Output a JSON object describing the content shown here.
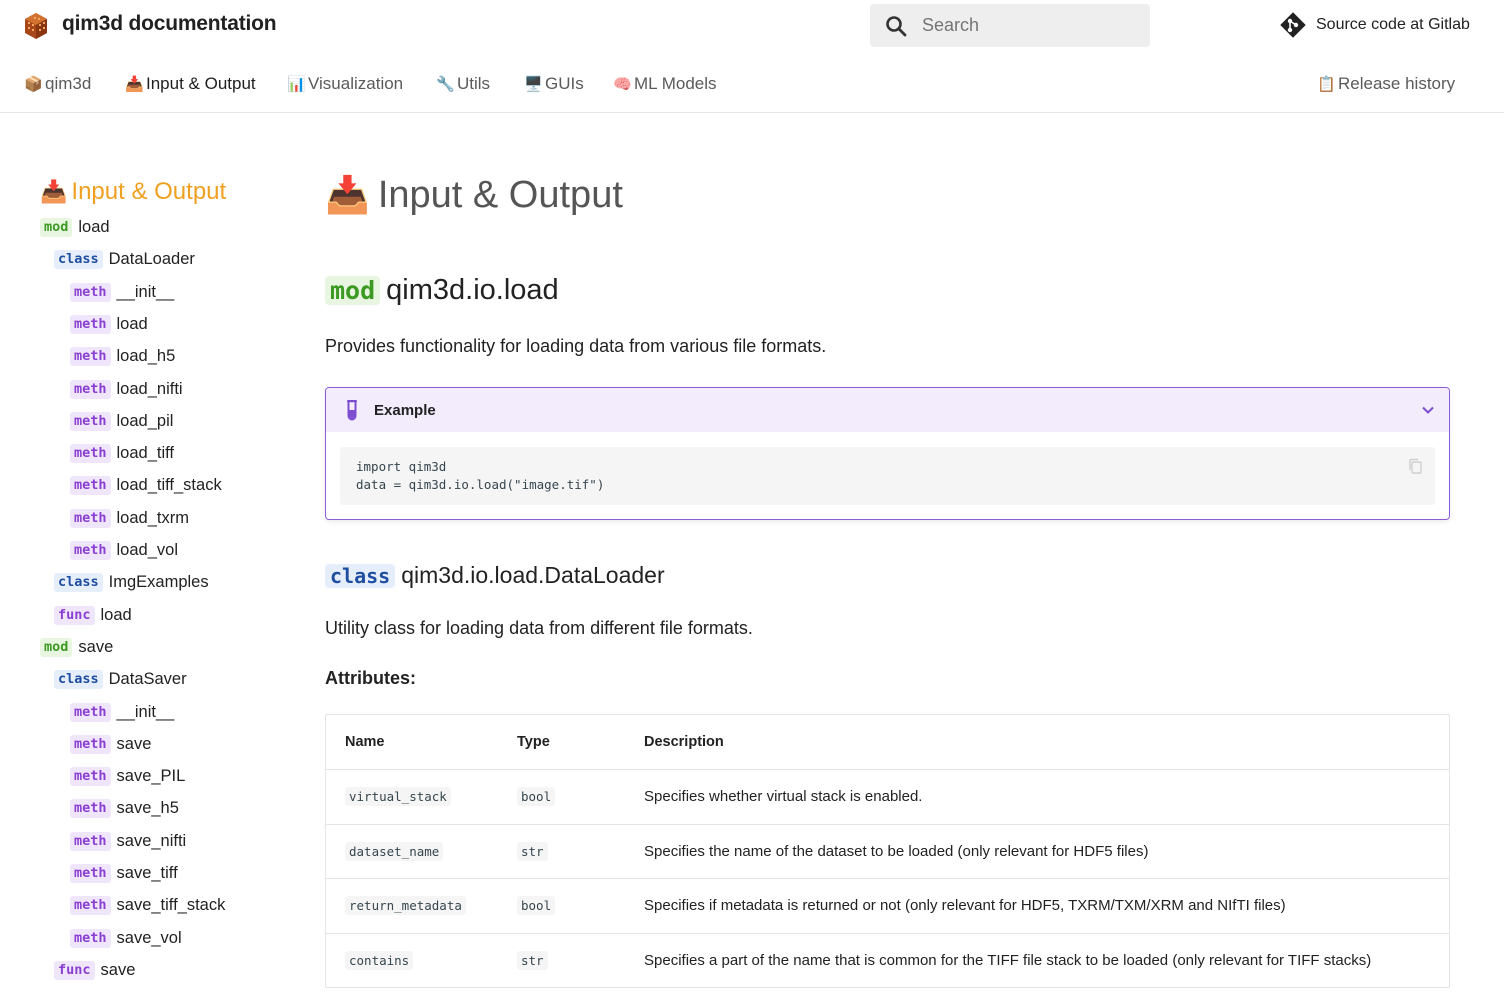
{
  "header": {
    "site_title": "qim3d documentation",
    "search_placeholder": "Search",
    "repo_label": "Source code at Gitlab"
  },
  "tabs": [
    {
      "icon": "📦",
      "label": "qim3d",
      "active": false
    },
    {
      "icon": "📥",
      "label": "Input & Output",
      "active": true
    },
    {
      "icon": "📊",
      "label": "Visualization",
      "active": false
    },
    {
      "icon": "🔧",
      "label": "Utils",
      "active": false
    },
    {
      "icon": "🖥️",
      "label": "GUIs",
      "active": false
    },
    {
      "icon": "🧠",
      "label": "ML Models",
      "active": false
    },
    {
      "icon": "📋",
      "label": "Release history",
      "active": false
    }
  ],
  "sidebar": {
    "title_icon": "📥",
    "title": "Input & Output",
    "items": [
      {
        "kind": "mod",
        "label": "load"
      },
      {
        "kind": "class",
        "label": "DataLoader"
      },
      {
        "kind": "meth",
        "label": "__init__"
      },
      {
        "kind": "meth",
        "label": "load"
      },
      {
        "kind": "meth",
        "label": "load_h5"
      },
      {
        "kind": "meth",
        "label": "load_nifti"
      },
      {
        "kind": "meth",
        "label": "load_pil"
      },
      {
        "kind": "meth",
        "label": "load_tiff"
      },
      {
        "kind": "meth",
        "label": "load_tiff_stack"
      },
      {
        "kind": "meth",
        "label": "load_txrm"
      },
      {
        "kind": "meth",
        "label": "load_vol"
      },
      {
        "kind": "class",
        "label": "ImgExamples"
      },
      {
        "kind": "func",
        "label": "load"
      },
      {
        "kind": "mod",
        "label": "save"
      },
      {
        "kind": "class",
        "label": "DataSaver"
      },
      {
        "kind": "meth",
        "label": "__init__"
      },
      {
        "kind": "meth",
        "label": "save"
      },
      {
        "kind": "meth",
        "label": "save_PIL"
      },
      {
        "kind": "meth",
        "label": "save_h5"
      },
      {
        "kind": "meth",
        "label": "save_nifti"
      },
      {
        "kind": "meth",
        "label": "save_tiff"
      },
      {
        "kind": "meth",
        "label": "save_tiff_stack"
      },
      {
        "kind": "meth",
        "label": "save_vol"
      },
      {
        "kind": "func",
        "label": "save"
      }
    ]
  },
  "main": {
    "page_title_icon": "📥",
    "page_title": "Input & Output",
    "module": {
      "badge": "mod",
      "name": "qim3d.io.load"
    },
    "module_desc": "Provides functionality for loading data from various file formats.",
    "example": {
      "title": "Example",
      "code_line1": "import qim3d",
      "code_line2": "data = qim3d.io.load(\"image.tif\")"
    },
    "class": {
      "badge": "class",
      "name": "qim3d.io.load.DataLoader"
    },
    "class_desc": "Utility class for loading data from different file formats.",
    "attributes_heading": "Attributes:",
    "table": {
      "headers": [
        "Name",
        "Type",
        "Description"
      ],
      "rows": [
        [
          "virtual_stack",
          "bool",
          "Specifies whether virtual stack is enabled."
        ],
        [
          "dataset_name",
          "str",
          "Specifies the name of the dataset to be loaded (only relevant for HDF5 files)"
        ],
        [
          "return_metadata",
          "bool",
          "Specifies if metadata is returned or not (only relevant for HDF5, TXRM/TXM/XRM and NIfTI files)"
        ],
        [
          "contains",
          "str",
          "Specifies a part of the name that is common for the TIFF file stack to be loaded (only relevant for TIFF stacks)"
        ]
      ]
    }
  },
  "colors": {
    "accent_orange": "#f0a020",
    "admonition_purple": "#8a5cd8",
    "mod_green": "#3c9a22",
    "class_blue": "#1f4ea0",
    "meth_purple": "#8a3fd1"
  }
}
